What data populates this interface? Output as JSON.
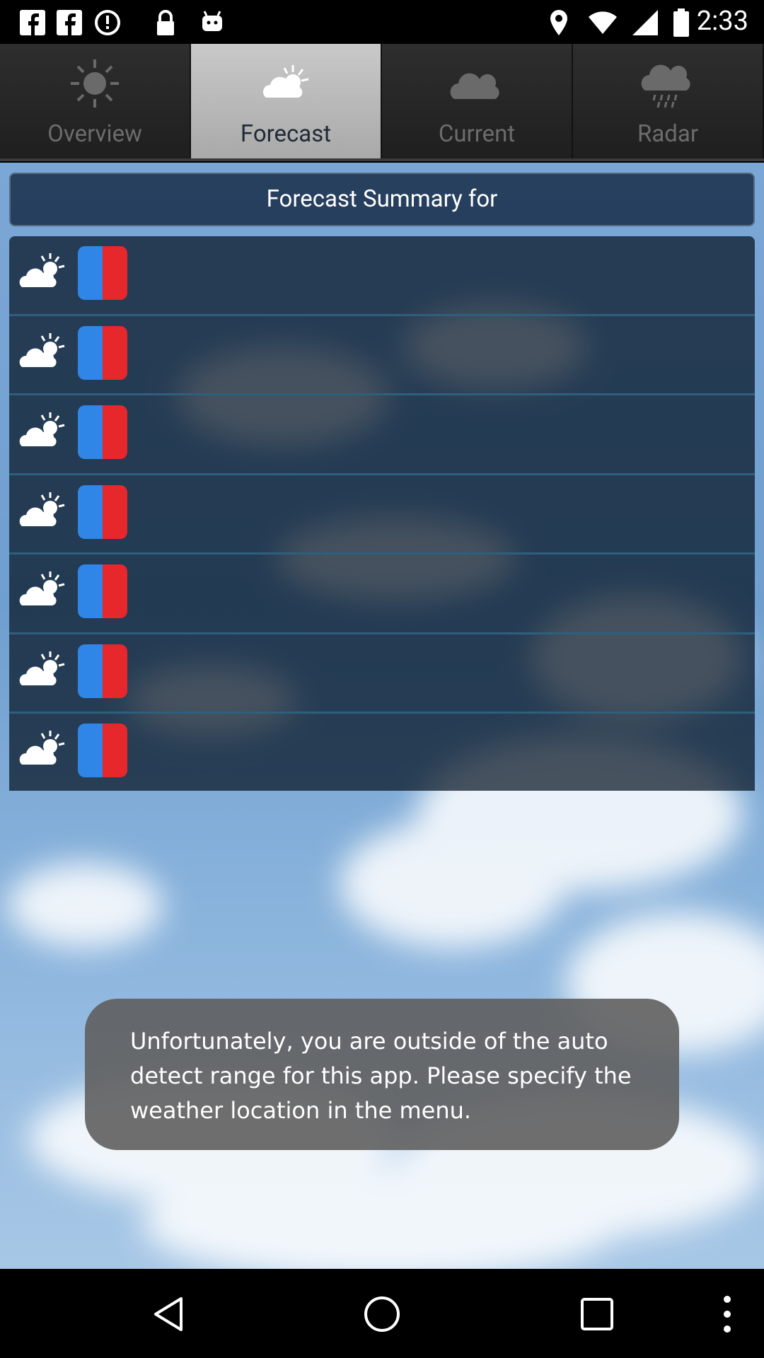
{
  "status_bar": {
    "time": "2:33",
    "icons": [
      "facebook-icon",
      "facebook-icon",
      "alert-icon",
      "lock-icon",
      "android-icon",
      "location-icon",
      "wifi-icon",
      "signal-icon",
      "battery-icon"
    ]
  },
  "tabs": [
    {
      "label": "Overview",
      "icon": "sun-icon",
      "active": false
    },
    {
      "label": "Forecast",
      "icon": "sun-cloud-icon",
      "active": true
    },
    {
      "label": "Current",
      "icon": "cloud-icon",
      "active": false
    },
    {
      "label": "Radar",
      "icon": "rain-cloud-icon",
      "active": false
    }
  ],
  "summary": {
    "title": "Forecast Summary for"
  },
  "forecast_rows": [
    {
      "weather_icon": "sun-cloud-icon",
      "temp_icon": "thermometer-icon"
    },
    {
      "weather_icon": "sun-cloud-icon",
      "temp_icon": "thermometer-icon"
    },
    {
      "weather_icon": "sun-cloud-icon",
      "temp_icon": "thermometer-icon"
    },
    {
      "weather_icon": "sun-cloud-icon",
      "temp_icon": "thermometer-icon"
    },
    {
      "weather_icon": "sun-cloud-icon",
      "temp_icon": "thermometer-icon"
    },
    {
      "weather_icon": "sun-cloud-icon",
      "temp_icon": "thermometer-icon"
    },
    {
      "weather_icon": "sun-cloud-icon",
      "temp_icon": "thermometer-icon"
    }
  ],
  "toast": {
    "message": "Unfortunately, you are outside of the auto detect range for this app. Please specify the weather location in the menu."
  },
  "colors": {
    "temp_cold": "#2f86e6",
    "temp_hot": "#e6272b",
    "active_tab": "#c0c0c0"
  },
  "nav_bar": {
    "icons": [
      "back-icon",
      "home-icon",
      "recents-icon",
      "menu-icon"
    ]
  }
}
